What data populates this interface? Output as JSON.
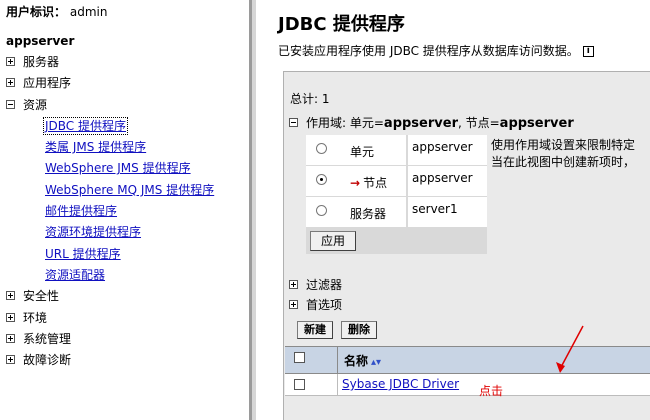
{
  "nav": {
    "user_label": "用户标识：",
    "user_name": "admin",
    "server": "appserver",
    "tree": [
      {
        "label": "服务器",
        "expanded": false
      },
      {
        "label": "应用程序",
        "expanded": false
      },
      {
        "label": "资源",
        "expanded": true
      }
    ],
    "resources": [
      "JDBC 提供程序",
      "类属 JMS 提供程序",
      "WebSphere JMS 提供程序",
      "WebSphere MQ JMS 提供程序",
      "邮件提供程序",
      "资源环境提供程序",
      "URL 提供程序",
      "资源适配器"
    ],
    "tree_after": [
      {
        "label": "安全性",
        "expanded": false
      },
      {
        "label": "环境",
        "expanded": false
      },
      {
        "label": "系统管理",
        "expanded": false
      },
      {
        "label": "故障诊断",
        "expanded": false
      }
    ]
  },
  "main": {
    "title": "JDBC 提供程序",
    "description": "已安装应用程序使用 JDBC 提供程序从数据库访问数据。",
    "info_icon": "i",
    "total": "总计: 1",
    "scope": {
      "prefix": "作用域: 单元=",
      "cell": "appserver",
      "mid": ", 节点=",
      "node": "appserver",
      "options": [
        {
          "label": "单元",
          "value": "appserver",
          "checked": false
        },
        {
          "label": "节点",
          "value": "appserver",
          "checked": true
        },
        {
          "label": "服务器",
          "value": "server1",
          "checked": false
        }
      ],
      "apply_label": "应用",
      "help_line1": "使用作用域设置来限制特定",
      "help_line2": "当在此视图中创建新项时，"
    },
    "filters_label": "过滤器",
    "prefs_label": "首选项",
    "new_label": "新建",
    "delete_label": "删除",
    "table": {
      "name_header": "名称",
      "rows": [
        {
          "name": "Sybase JDBC Driver"
        }
      ]
    },
    "annotation": "点击",
    "colors": {
      "link": "#1010c0",
      "annotation": "#e00000",
      "header_bg": "#c8d4e4",
      "panel_bg": "#eaeaea"
    }
  }
}
